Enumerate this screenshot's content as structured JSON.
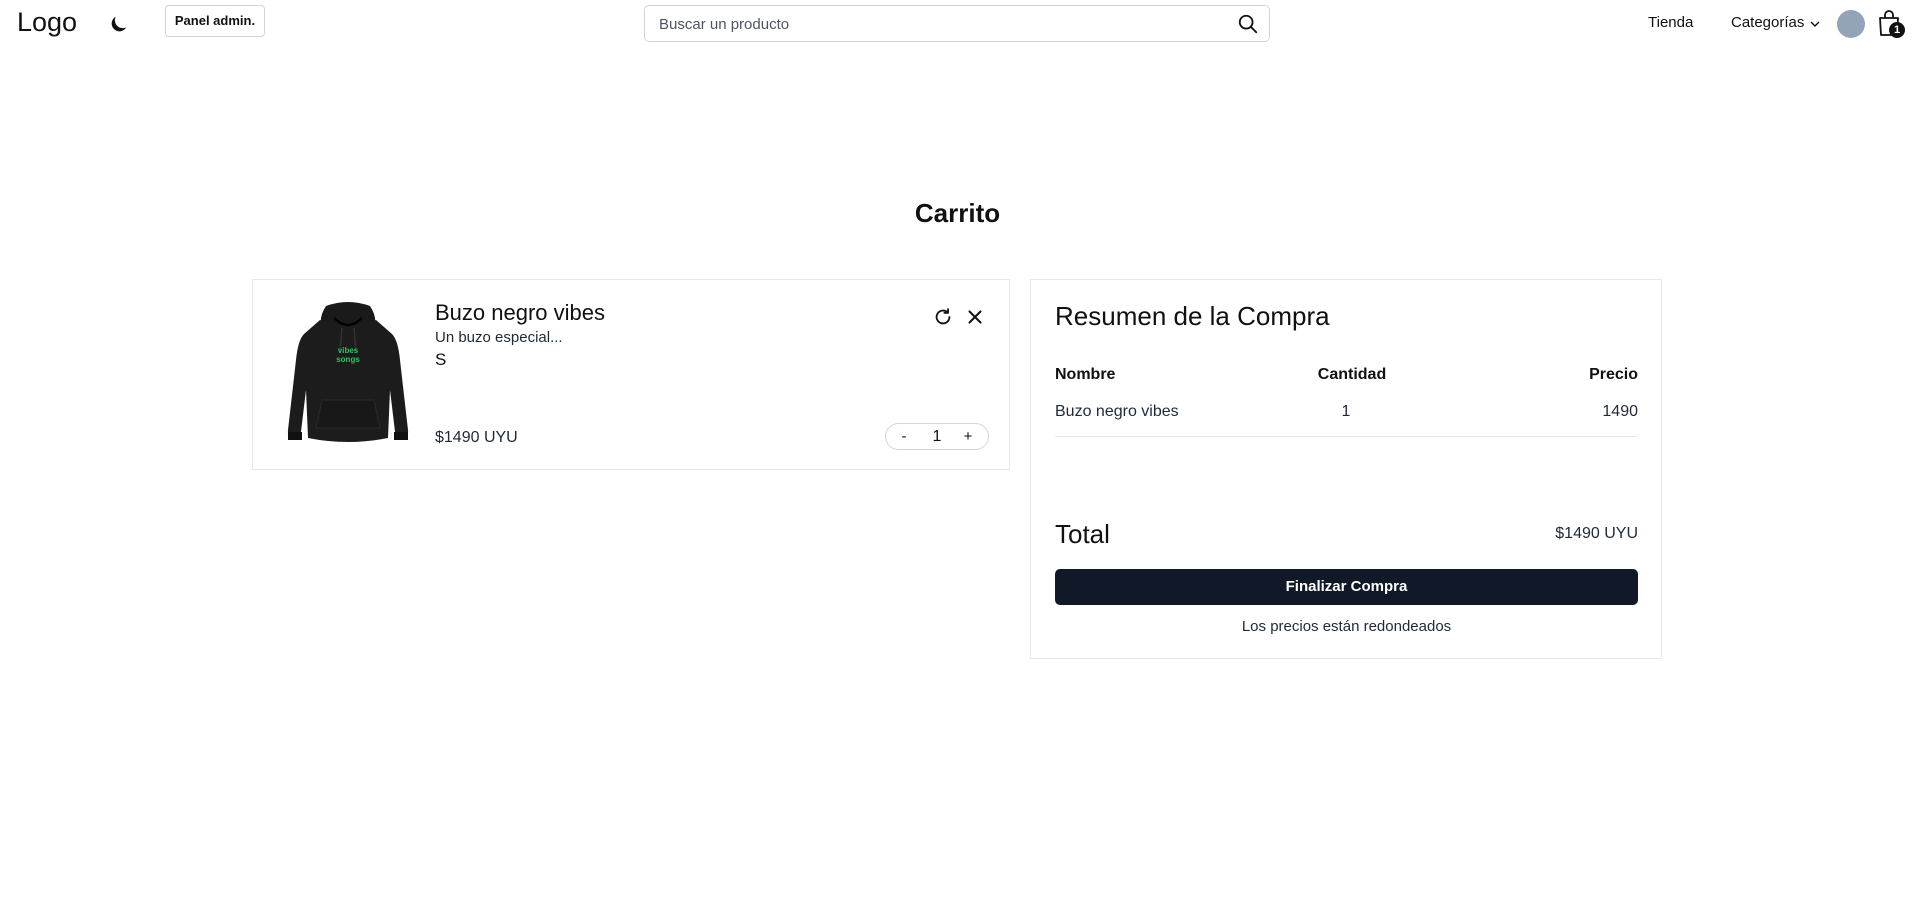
{
  "header": {
    "logo": "Logo",
    "admin_button": "Panel admin.",
    "search_placeholder": "Buscar un producto",
    "nav": {
      "tienda": "Tienda",
      "categorias": "Categorías"
    },
    "cart_count": "1"
  },
  "page": {
    "title": "Carrito"
  },
  "cart_items": [
    {
      "name": "Buzo negro vibes",
      "description": "Un buzo especial...",
      "size": "S",
      "price": "$1490 UYU",
      "quantity": "1",
      "print_text_line1": "vibes",
      "print_text_line2": "songs",
      "stepper": {
        "minus": "-",
        "plus": "+"
      }
    }
  ],
  "summary": {
    "title": "Resumen de la Compra",
    "headers": {
      "name": "Nombre",
      "qty": "Cantidad",
      "price": "Precio"
    },
    "rows": [
      {
        "name": "Buzo negro vibes",
        "qty": "1",
        "price": "1490"
      }
    ],
    "total_label": "Total",
    "total_value": "$1490 UYU",
    "checkout_button": "Finalizar Compra",
    "note": "Los precios están redondeados"
  },
  "colors": {
    "primary_button": "#111827",
    "border": "#e5e7eb",
    "avatar": "#94a3b8"
  }
}
